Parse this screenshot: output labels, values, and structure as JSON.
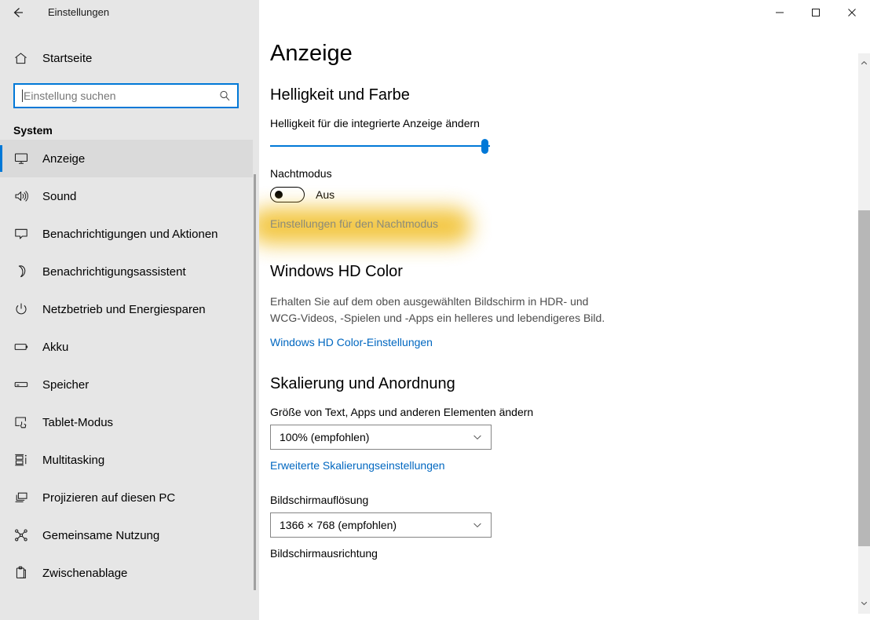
{
  "window": {
    "title": "Einstellungen",
    "back_icon": "back-arrow-icon",
    "minimize_label": "minimize-icon",
    "maximize_label": "maximize-icon",
    "close_label": "close-icon"
  },
  "sidebar": {
    "home": {
      "label": "Startseite",
      "icon": "home-icon"
    },
    "search": {
      "value": "",
      "placeholder": "Einstellung suchen",
      "icon": "search-icon"
    },
    "section_header": "System",
    "selected_index": 0,
    "accent_color": "#0078d7",
    "background_color": "#e6e6e6",
    "items": [
      {
        "label": "Anzeige",
        "icon": "monitor-icon"
      },
      {
        "label": "Sound",
        "icon": "speaker-icon"
      },
      {
        "label": "Benachrichtigungen und Aktionen",
        "icon": "chat-bubble-icon"
      },
      {
        "label": "Benachrichtigungsassistent",
        "icon": "moon-icon"
      },
      {
        "label": "Netzbetrieb und Energiesparen",
        "icon": "power-icon"
      },
      {
        "label": "Akku",
        "icon": "battery-icon"
      },
      {
        "label": "Speicher",
        "icon": "storage-icon"
      },
      {
        "label": "Tablet-Modus",
        "icon": "tablet-hand-icon"
      },
      {
        "label": "Multitasking",
        "icon": "multitasking-icon"
      },
      {
        "label": "Projizieren auf diesen PC",
        "icon": "project-screen-icon"
      },
      {
        "label": "Gemeinsame Nutzung",
        "icon": "share-icon"
      },
      {
        "label": "Zwischenablage",
        "icon": "clipboard-icon"
      }
    ]
  },
  "main": {
    "page_title": "Anzeige",
    "brightness_section": {
      "title": "Helligkeit und Farbe",
      "slider_label": "Helligkeit für die integrierte Anzeige ändern",
      "slider_value": 100,
      "slider_min": 0,
      "slider_max": 100,
      "night_mode_label": "Nachtmodus",
      "night_mode_state": "Aus",
      "night_mode_enabled": false,
      "night_mode_settings_link": "Einstellungen für den Nachtmodus",
      "highlight_color": "#f2c335"
    },
    "hd_color_section": {
      "title": "Windows HD Color",
      "description": "Erhalten Sie auf dem oben ausgewählten Bildschirm in HDR- und WCG-Videos, -Spielen und -Apps ein helleres und lebendigeres Bild.",
      "link": "Windows HD Color-Einstellungen"
    },
    "scaling_section": {
      "title": "Skalierung und Anordnung",
      "scale_label": "Größe von Text, Apps und anderen Elementen ändern",
      "scale_value": "100% (empfohlen)",
      "advanced_scaling_link": "Erweiterte Skalierungseinstellungen",
      "resolution_label": "Bildschirmauflösung",
      "resolution_value": "1366 × 768 (empfohlen)",
      "orientation_label": "Bildschirmausrichtung"
    }
  },
  "scrollbar": {
    "up_icon": "chevron-up-icon",
    "down_icon": "chevron-down-icon"
  }
}
